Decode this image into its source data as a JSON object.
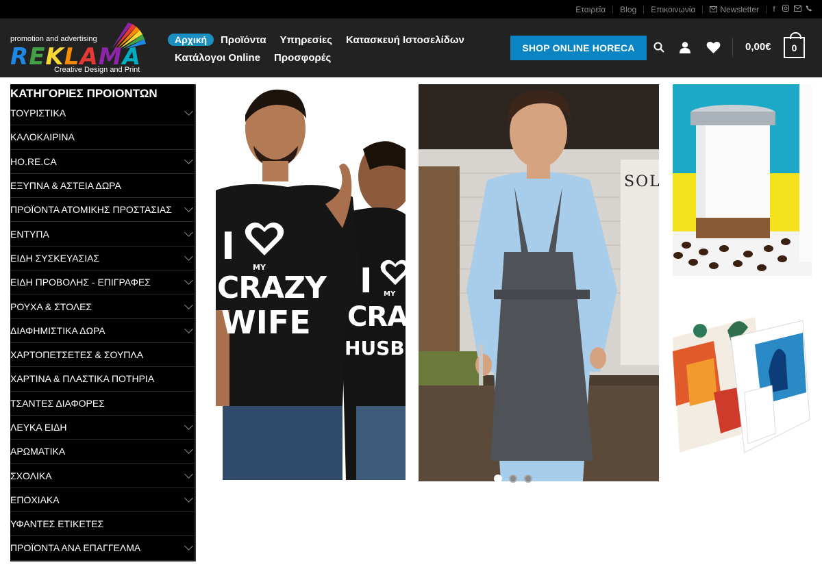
{
  "topbar": {
    "links": [
      "Εταιρεία",
      "Blog",
      "Επικοινωνία",
      "Newsletter"
    ],
    "social_icons": [
      "facebook-icon",
      "instagram-icon",
      "email-icon",
      "phone-icon"
    ]
  },
  "logo": {
    "tagline": "promotion and advertising",
    "brand": "REKLAMA",
    "sub": "Creative Design and Print"
  },
  "nav": {
    "row1": [
      "Αρχική",
      "Προϊόντα",
      "Υπηρεσίες",
      "Κατασκευή Ιστοσελίδων"
    ],
    "row2": [
      "Κατάλογοι Online",
      "Προσφορές"
    ]
  },
  "header": {
    "horeca_label": "SHOP ONLINE HORECA",
    "cart_total": "0,00€",
    "cart_count": "0"
  },
  "sidebar": {
    "title": "ΚΑΤΗΓΟΡΙΕΣ ΠΡΟΙΟΝΤΩΝ",
    "items": [
      {
        "label": "ΤΟΥΡΙΣΤΙΚΑ",
        "has_children": true
      },
      {
        "label": "ΚΑΛΟΚΑΙΡΙΝΑ",
        "has_children": false
      },
      {
        "label": "HO.RE.CA",
        "has_children": true
      },
      {
        "label": "ΕΞΥΠΝΑ & ΑΣΤΕΙΑ ΔΩΡΑ",
        "has_children": false
      },
      {
        "label": "ΠΡΟΪΟΝΤΑ ΑΤΟΜΙΚΗΣ ΠΡΟΣΤΑΣΙΑΣ",
        "has_children": true
      },
      {
        "label": "ΕΝΤΥΠΑ",
        "has_children": true
      },
      {
        "label": "ΕΙΔΗ ΣΥΣΚΕΥΑΣΙΑΣ",
        "has_children": true
      },
      {
        "label": "ΕΙΔΗ ΠΡΟΒΟΛΗΣ - ΕΠΙΓΡΑΦΕΣ",
        "has_children": true
      },
      {
        "label": "ΡΟΥΧΑ & ΣΤΟΛΕΣ",
        "has_children": true
      },
      {
        "label": "ΔΙΑΦΗΜΙΣΤΙΚΑ ΔΩΡΑ",
        "has_children": true
      },
      {
        "label": "ΧΑΡΤΟΠΕΤΣΕΤΕΣ & ΣΟΥΠΛΑ",
        "has_children": false
      },
      {
        "label": "ΧΑΡΤΙΝΑ & ΠΛΑΣΤΙΚΑ ΠΟΤΗΡΙΑ",
        "has_children": false
      },
      {
        "label": "ΤΣΑΝΤΕΣ ΔΙΑΦΟΡΕΣ",
        "has_children": false
      },
      {
        "label": "ΛΕΥΚΑ ΕΙΔΗ",
        "has_children": true
      },
      {
        "label": "ΑΡΩΜΑΤΙΚΑ",
        "has_children": true
      },
      {
        "label": "ΣΧΟΛΙΚΑ",
        "has_children": true
      },
      {
        "label": "ΕΠΟΧΙΑΚΑ",
        "has_children": true
      },
      {
        "label": "ΥΦΑΝΤΕΣ ΕΤΙΚΕΤΕΣ",
        "has_children": false
      },
      {
        "label": "ΠΡΟΪΟΝΤΑ ΑΝΑ ΕΠΑΓΓΕΛΜΑ",
        "has_children": true
      }
    ]
  },
  "promo": {
    "tshirt_left": [
      "I",
      "MY",
      "CRAZY",
      "WIFE"
    ],
    "tshirt_right": [
      "I",
      "MY",
      "CRAZ",
      "HUSB"
    ],
    "apron_brand": "SOL'S",
    "slider_dots": 3,
    "active_dot": 0
  },
  "colors": {
    "accent": "#0a84c3",
    "header_bg": "#222222",
    "topbar_bg": "#000000",
    "sidebar_bg": "#000000"
  }
}
